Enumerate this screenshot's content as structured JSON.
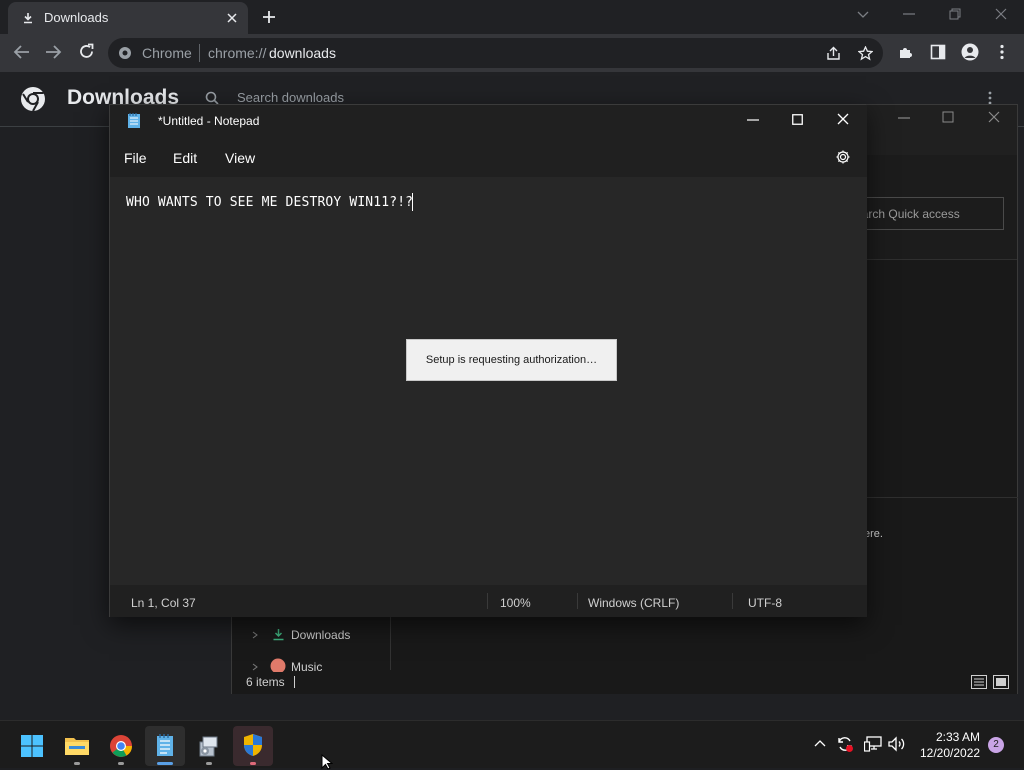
{
  "chrome": {
    "tab_title": "Downloads",
    "omnibox_site_label": "Chrome",
    "omnibox_url_prefix": "chrome://",
    "omnibox_url_path": "downloads",
    "page_title": "Downloads",
    "search_placeholder": "Search downloads"
  },
  "explorer": {
    "search_placeholder": "Search Quick access",
    "hint_fragment": "ere.",
    "nav_items": [
      "Downloads",
      "Music"
    ],
    "status_items": "6 items"
  },
  "notepad": {
    "title": "*Untitled - Notepad",
    "menu": [
      "File",
      "Edit",
      "View"
    ],
    "text": "WHO WANTS TO SEE ME DESTROY WIN11?!?",
    "status": {
      "position": "Ln 1, Col 37",
      "zoom": "100%",
      "line_endings": "Windows (CRLF)",
      "encoding": "UTF-8"
    }
  },
  "dialog": {
    "message": "Setup is requesting authorization…"
  },
  "taskbar": {
    "time": "2:33 AM",
    "date": "12/20/2022",
    "notification_count": "2",
    "apps": [
      "start-icon",
      "file-explorer-icon",
      "chrome-icon",
      "notepad-icon",
      "setup-icon",
      "uac-shield-icon"
    ]
  },
  "colors": {
    "accent_blue": "#5aa0e6",
    "notification_badge": "#c9a4e6"
  }
}
